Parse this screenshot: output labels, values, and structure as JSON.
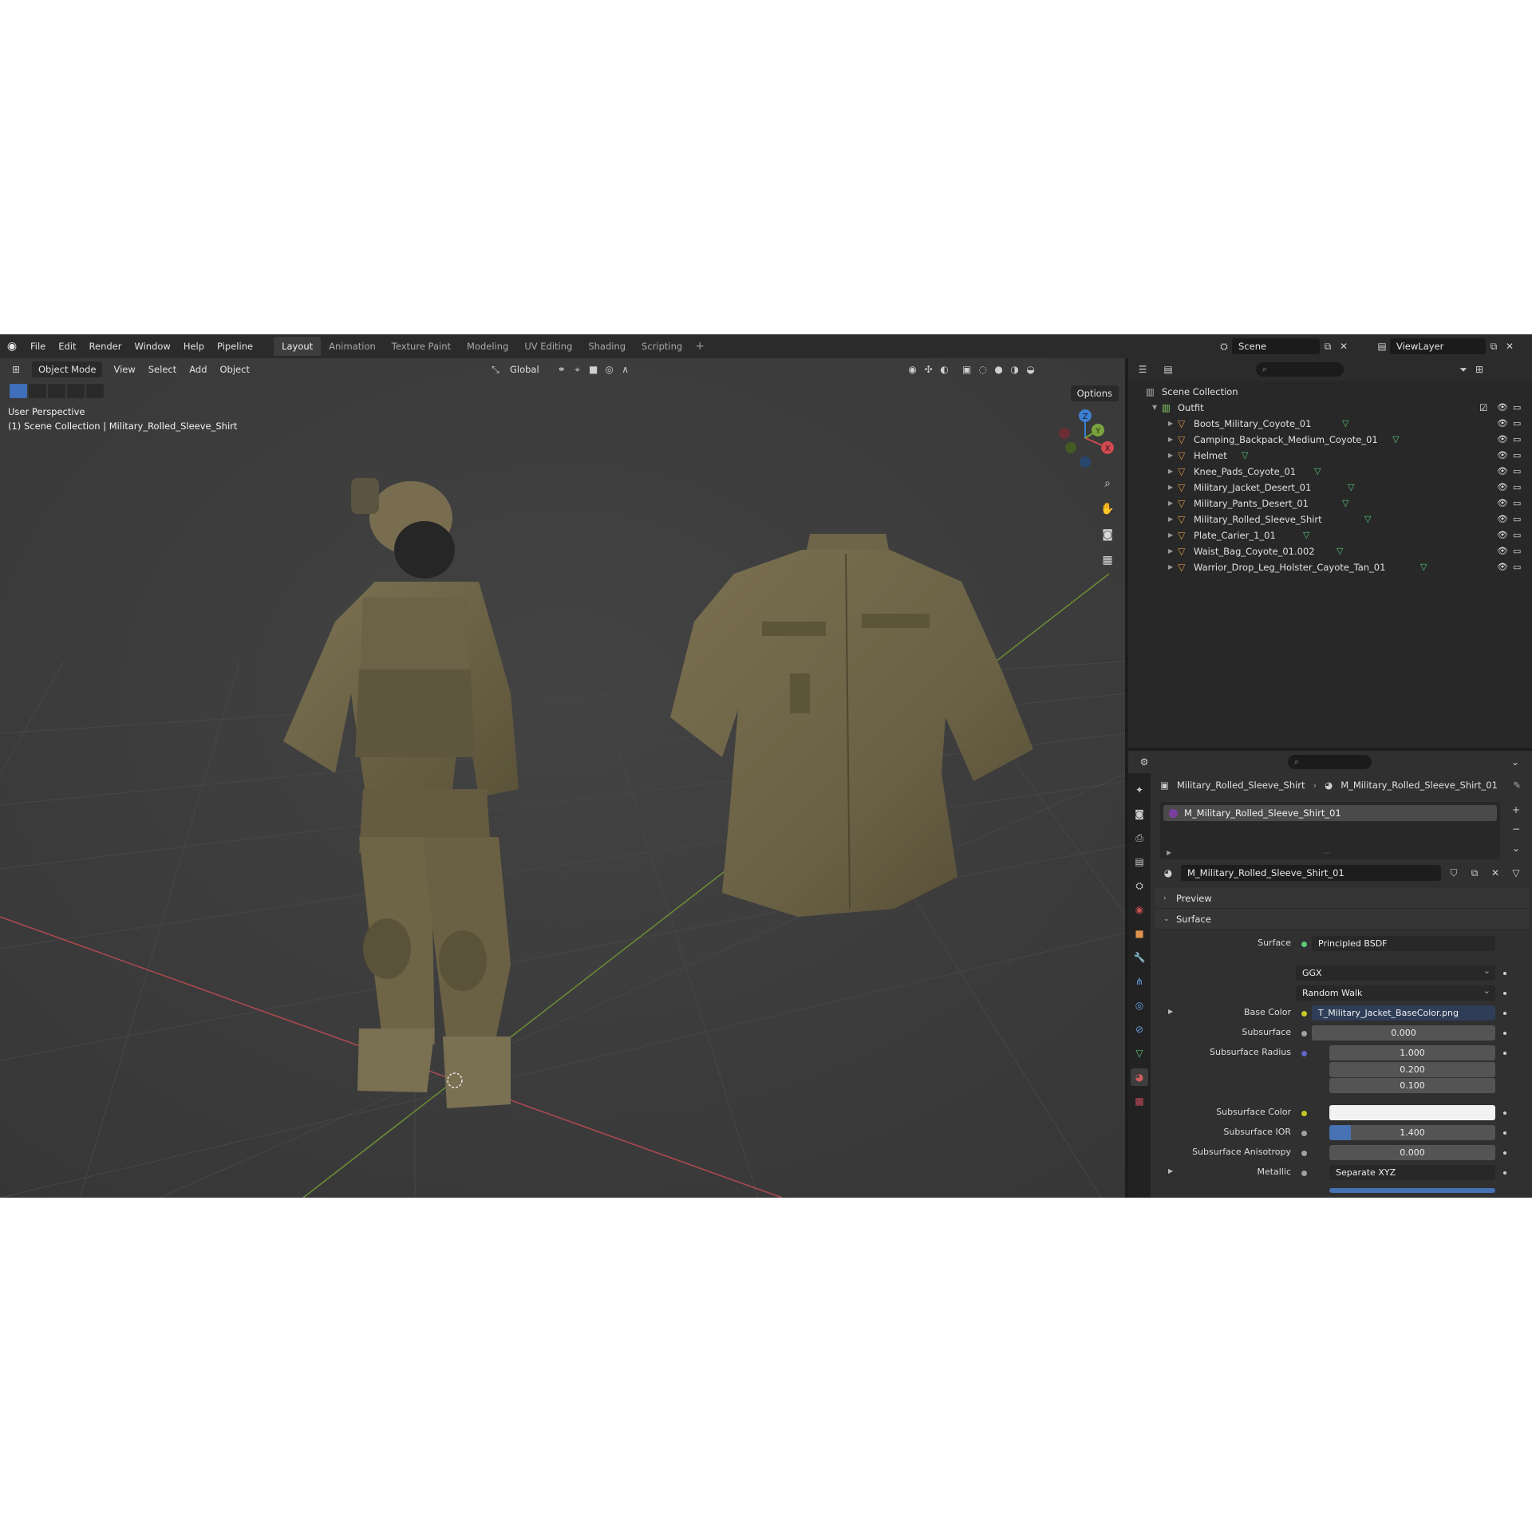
{
  "menu": [
    "File",
    "Edit",
    "Render",
    "Window",
    "Help",
    "Pipeline"
  ],
  "workspaces": [
    {
      "label": "Layout",
      "active": true
    },
    {
      "label": "Animation",
      "active": false
    },
    {
      "label": "Texture Paint",
      "active": false
    },
    {
      "label": "Modeling",
      "active": false
    },
    {
      "label": "UV Editing",
      "active": false
    },
    {
      "label": "Shading",
      "active": false
    },
    {
      "label": "Scripting",
      "active": false
    }
  ],
  "scene": "Scene",
  "view_layer": "ViewLayer",
  "viewport": {
    "mode": "Object Mode",
    "menus": [
      "View",
      "Select",
      "Add",
      "Object"
    ],
    "transform_orientation": "Global",
    "options_label": "Options",
    "perspective": "User Perspective",
    "context": "(1) Scene Collection | Military_Rolled_Sleeve_Shirt",
    "gizmo": {
      "x": "X",
      "y": "Y",
      "z": "Z"
    }
  },
  "outliner": {
    "root": "Scene Collection",
    "collection": "Outfit",
    "objects": [
      "Boots_Military_Coyote_01",
      "Camping_Backpack_Medium_Coyote_01",
      "Helmet",
      "Knee_Pads_Coyote_01",
      "Military_Jacket_Desert_01",
      "Military_Pants_Desert_01",
      "Military_Rolled_Sleeve_Shirt",
      "Plate_Carier_1_01",
      "Waist_Bag_Coyote_01.002",
      "Warrior_Drop_Leg_Holster_Cayote_Tan_01"
    ]
  },
  "properties": {
    "breadcrumb_object": "Military_Rolled_Sleeve_Shirt",
    "breadcrumb_material": "M_Military_Rolled_Sleeve_Shirt_01",
    "slot": "M_Military_Rolled_Sleeve_Shirt_01",
    "material_name": "M_Military_Rolled_Sleeve_Shirt_01",
    "panels": {
      "preview": "Preview",
      "surface": "Surface"
    },
    "surface_shader": "Principled BSDF",
    "distribution": "GGX",
    "subsurface_method": "Random Walk",
    "rows": {
      "surface_label": "Surface",
      "base_color_label": "Base Color",
      "base_color_value": "T_Military_Jacket_BaseColor.png",
      "subsurface_label": "Subsurface",
      "subsurface_value": "0.000",
      "subsurface_radius_label": "Subsurface Radius",
      "radius": [
        "1.000",
        "0.200",
        "0.100"
      ],
      "subsurface_color_label": "Subsurface Color",
      "subsurface_ior_label": "Subsurface IOR",
      "subsurface_ior_value": "1.400",
      "subsurface_ior_fill": 0.13,
      "subsurface_aniso_label": "Subsurface Anisotropy",
      "subsurface_aniso_value": "0.000",
      "metallic_label": "Metallic",
      "metallic_value": "Separate XYZ"
    }
  },
  "colors": {
    "accent": "#4772b3",
    "outliner_mesh": "#e0934c",
    "mesh_data": "#59c97a",
    "axis_x": "#d04a4f",
    "axis_y": "#7ba33d",
    "axis_z": "#3d7fd1",
    "model_cloth": "#6e6446"
  }
}
